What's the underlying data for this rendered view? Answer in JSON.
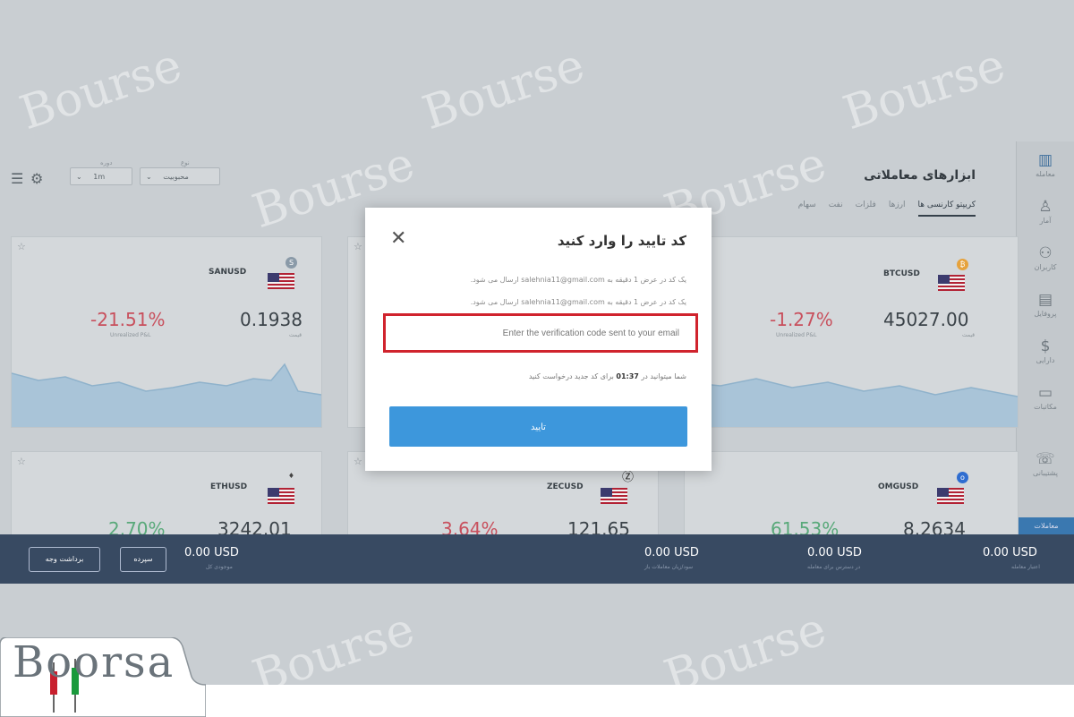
{
  "header": {
    "title": "ابزارهای معاملاتی",
    "tabs": [
      {
        "label": "کریپتو کارنسی ها",
        "active": true
      },
      {
        "label": "ارزها"
      },
      {
        "label": "فلزات"
      },
      {
        "label": "نفت"
      },
      {
        "label": "سهام"
      }
    ],
    "controls": {
      "chart_type_label": "نوع نمودار",
      "chart_type_value": "محبوبیت",
      "period_label": "دوره زمانی",
      "period_value": "1m"
    }
  },
  "sidebar": {
    "items": [
      {
        "icon": "chart-icon",
        "label": "معامله"
      },
      {
        "icon": "user-icon",
        "label": "آمار"
      },
      {
        "icon": "users-icon",
        "label": "کاربران"
      },
      {
        "icon": "id-card-icon",
        "label": "پروفایل"
      },
      {
        "icon": "dollar-icon",
        "label": "دارایی"
      },
      {
        "icon": "window-icon",
        "label": "مکاتبات"
      },
      {
        "icon": "support-icon",
        "label": "پشتیبانی"
      }
    ],
    "chat_label": "معاملات"
  },
  "cards": [
    {
      "symbol": "BTCUSD",
      "price": "45027.00",
      "price_label": "قیمت",
      "change": "-1.27%",
      "change_label": "Unrealized P&L",
      "trend": "down",
      "coin_color": "#e6a23c",
      "coin_glyph": "₿"
    },
    {
      "symbol": "SANUSD",
      "price": "0.1938",
      "price_label": "قیمت",
      "change": "-21.51%",
      "change_label": "Unrealized P&L",
      "trend": "down",
      "coin_color": "#8a9aa8",
      "coin_glyph": "S"
    },
    {
      "symbol": "OMGUSD",
      "price": "8.2634",
      "change": "61.53%",
      "trend": "up",
      "coin_color": "#2f6dd0",
      "coin_glyph": "o"
    },
    {
      "symbol": "ZECUSD",
      "price": "121.65",
      "change": "3.64%",
      "trend": "down",
      "coin_color": "#222222",
      "coin_glyph": "Ⓩ"
    },
    {
      "symbol": "ETHUSD",
      "price": "3242.01",
      "change": "2.70%",
      "trend": "up",
      "coin_color": "#444444",
      "coin_glyph": "♦"
    }
  ],
  "bottom_bar": {
    "withdraw_label": "برداشت وجه",
    "deposit_label": "سپرده",
    "balances": [
      {
        "value": "0.00 USD",
        "label": "موجودی کل"
      },
      {
        "value": "0.00 USD",
        "label": "سود/زیان معاملات باز"
      },
      {
        "value": "0.00 USD",
        "label": "در دسترس برای معامله"
      },
      {
        "value": "0.00 USD",
        "label": "اعتبار معامله"
      }
    ]
  },
  "dialog": {
    "title": "کد تایید را وارد کنید",
    "message_1": "یک کد در عرض 1 دقیقه به salehnia11@gmail.com ارسال می شود.",
    "message_2": "یک کد در عرض 1 دقیقه به salehnia11@gmail.com ارسال می شود.",
    "input_placeholder": "Enter the verification code sent to your email",
    "timer_prefix": "شما میتوانید در",
    "timer_value": "01:37",
    "timer_suffix": "برای کد جدید درخواست کنید",
    "submit_label": "تایید"
  },
  "watermark": "Bourse",
  "logo": {
    "text": "Boorsa"
  }
}
